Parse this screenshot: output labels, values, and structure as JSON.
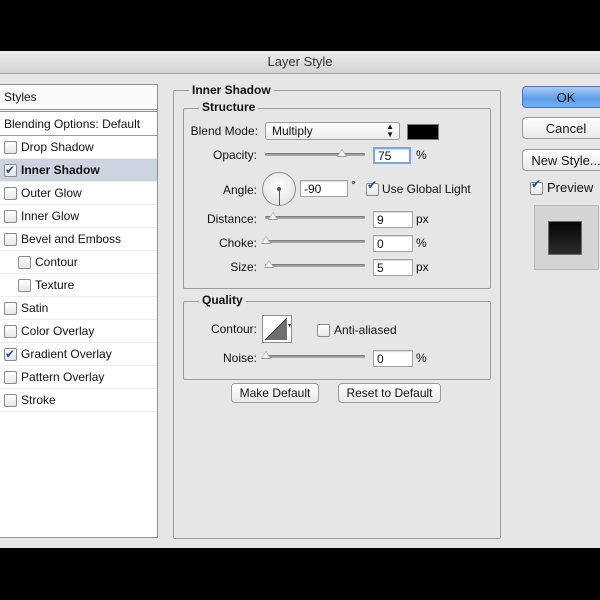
{
  "window": {
    "title": "Layer Style"
  },
  "styles": {
    "header": "Styles",
    "blending_options": "Blending Options: Default",
    "items": [
      {
        "label": "Drop Shadow",
        "checked": false
      },
      {
        "label": "Inner Shadow",
        "checked": true
      },
      {
        "label": "Outer Glow",
        "checked": false
      },
      {
        "label": "Inner Glow",
        "checked": false
      },
      {
        "label": "Bevel and Emboss",
        "checked": false
      },
      {
        "label": "Contour",
        "checked": false
      },
      {
        "label": "Texture",
        "checked": false
      },
      {
        "label": "Satin",
        "checked": false
      },
      {
        "label": "Color Overlay",
        "checked": false
      },
      {
        "label": "Gradient Overlay",
        "checked": true
      },
      {
        "label": "Pattern Overlay",
        "checked": false
      },
      {
        "label": "Stroke",
        "checked": false
      }
    ]
  },
  "inner_shadow": {
    "title": "Inner Shadow",
    "structure": {
      "title": "Structure",
      "blend_mode_label": "Blend Mode:",
      "blend_mode_value": "Multiply",
      "color": "#000000",
      "opacity_label": "Opacity:",
      "opacity_value": "75",
      "opacity_unit": "%",
      "angle_label": "Angle:",
      "angle_value": "-90",
      "angle_unit": "°",
      "use_global_light_label": "Use Global Light",
      "use_global_light_checked": true,
      "distance_label": "Distance:",
      "distance_value": "9",
      "distance_unit": "px",
      "choke_label": "Choke:",
      "choke_value": "0",
      "choke_unit": "%",
      "size_label": "Size:",
      "size_value": "5",
      "size_unit": "px"
    },
    "quality": {
      "title": "Quality",
      "contour_label": "Contour:",
      "anti_aliased_label": "Anti-aliased",
      "anti_aliased_checked": false,
      "noise_label": "Noise:",
      "noise_value": "0",
      "noise_unit": "%"
    },
    "make_default_label": "Make Default",
    "reset_default_label": "Reset to Default"
  },
  "buttons": {
    "ok": "OK",
    "cancel": "Cancel",
    "new_style": "New Style...",
    "preview_label": "Preview",
    "preview_checked": true
  }
}
